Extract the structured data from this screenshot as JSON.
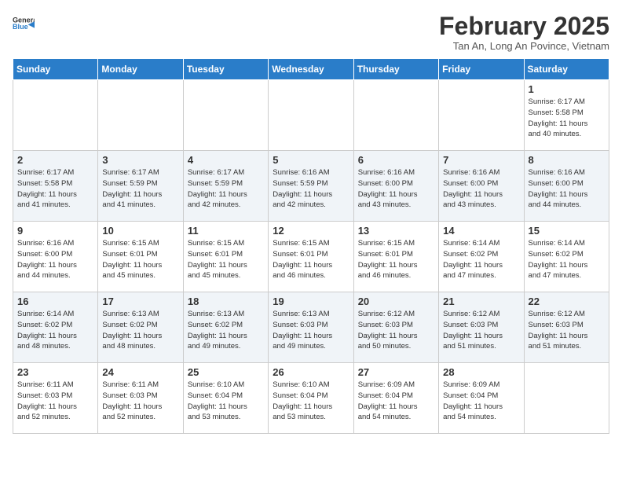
{
  "header": {
    "logo": {
      "general": "General",
      "blue": "Blue"
    },
    "title": "February 2025",
    "subtitle": "Tan An, Long An Povince, Vietnam"
  },
  "weekdays": [
    "Sunday",
    "Monday",
    "Tuesday",
    "Wednesday",
    "Thursday",
    "Friday",
    "Saturday"
  ],
  "weeks": [
    [
      {
        "day": "",
        "info": ""
      },
      {
        "day": "",
        "info": ""
      },
      {
        "day": "",
        "info": ""
      },
      {
        "day": "",
        "info": ""
      },
      {
        "day": "",
        "info": ""
      },
      {
        "day": "",
        "info": ""
      },
      {
        "day": "1",
        "info": "Sunrise: 6:17 AM\nSunset: 5:58 PM\nDaylight: 11 hours\nand 40 minutes."
      }
    ],
    [
      {
        "day": "2",
        "info": "Sunrise: 6:17 AM\nSunset: 5:58 PM\nDaylight: 11 hours\nand 41 minutes."
      },
      {
        "day": "3",
        "info": "Sunrise: 6:17 AM\nSunset: 5:59 PM\nDaylight: 11 hours\nand 41 minutes."
      },
      {
        "day": "4",
        "info": "Sunrise: 6:17 AM\nSunset: 5:59 PM\nDaylight: 11 hours\nand 42 minutes."
      },
      {
        "day": "5",
        "info": "Sunrise: 6:16 AM\nSunset: 5:59 PM\nDaylight: 11 hours\nand 42 minutes."
      },
      {
        "day": "6",
        "info": "Sunrise: 6:16 AM\nSunset: 6:00 PM\nDaylight: 11 hours\nand 43 minutes."
      },
      {
        "day": "7",
        "info": "Sunrise: 6:16 AM\nSunset: 6:00 PM\nDaylight: 11 hours\nand 43 minutes."
      },
      {
        "day": "8",
        "info": "Sunrise: 6:16 AM\nSunset: 6:00 PM\nDaylight: 11 hours\nand 44 minutes."
      }
    ],
    [
      {
        "day": "9",
        "info": "Sunrise: 6:16 AM\nSunset: 6:00 PM\nDaylight: 11 hours\nand 44 minutes."
      },
      {
        "day": "10",
        "info": "Sunrise: 6:15 AM\nSunset: 6:01 PM\nDaylight: 11 hours\nand 45 minutes."
      },
      {
        "day": "11",
        "info": "Sunrise: 6:15 AM\nSunset: 6:01 PM\nDaylight: 11 hours\nand 45 minutes."
      },
      {
        "day": "12",
        "info": "Sunrise: 6:15 AM\nSunset: 6:01 PM\nDaylight: 11 hours\nand 46 minutes."
      },
      {
        "day": "13",
        "info": "Sunrise: 6:15 AM\nSunset: 6:01 PM\nDaylight: 11 hours\nand 46 minutes."
      },
      {
        "day": "14",
        "info": "Sunrise: 6:14 AM\nSunset: 6:02 PM\nDaylight: 11 hours\nand 47 minutes."
      },
      {
        "day": "15",
        "info": "Sunrise: 6:14 AM\nSunset: 6:02 PM\nDaylight: 11 hours\nand 47 minutes."
      }
    ],
    [
      {
        "day": "16",
        "info": "Sunrise: 6:14 AM\nSunset: 6:02 PM\nDaylight: 11 hours\nand 48 minutes."
      },
      {
        "day": "17",
        "info": "Sunrise: 6:13 AM\nSunset: 6:02 PM\nDaylight: 11 hours\nand 48 minutes."
      },
      {
        "day": "18",
        "info": "Sunrise: 6:13 AM\nSunset: 6:02 PM\nDaylight: 11 hours\nand 49 minutes."
      },
      {
        "day": "19",
        "info": "Sunrise: 6:13 AM\nSunset: 6:03 PM\nDaylight: 11 hours\nand 49 minutes."
      },
      {
        "day": "20",
        "info": "Sunrise: 6:12 AM\nSunset: 6:03 PM\nDaylight: 11 hours\nand 50 minutes."
      },
      {
        "day": "21",
        "info": "Sunrise: 6:12 AM\nSunset: 6:03 PM\nDaylight: 11 hours\nand 51 minutes."
      },
      {
        "day": "22",
        "info": "Sunrise: 6:12 AM\nSunset: 6:03 PM\nDaylight: 11 hours\nand 51 minutes."
      }
    ],
    [
      {
        "day": "23",
        "info": "Sunrise: 6:11 AM\nSunset: 6:03 PM\nDaylight: 11 hours\nand 52 minutes."
      },
      {
        "day": "24",
        "info": "Sunrise: 6:11 AM\nSunset: 6:03 PM\nDaylight: 11 hours\nand 52 minutes."
      },
      {
        "day": "25",
        "info": "Sunrise: 6:10 AM\nSunset: 6:04 PM\nDaylight: 11 hours\nand 53 minutes."
      },
      {
        "day": "26",
        "info": "Sunrise: 6:10 AM\nSunset: 6:04 PM\nDaylight: 11 hours\nand 53 minutes."
      },
      {
        "day": "27",
        "info": "Sunrise: 6:09 AM\nSunset: 6:04 PM\nDaylight: 11 hours\nand 54 minutes."
      },
      {
        "day": "28",
        "info": "Sunrise: 6:09 AM\nSunset: 6:04 PM\nDaylight: 11 hours\nand 54 minutes."
      },
      {
        "day": "",
        "info": ""
      }
    ]
  ]
}
